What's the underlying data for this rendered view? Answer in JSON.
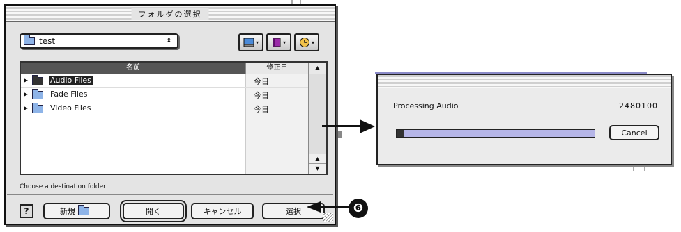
{
  "folder_dialog": {
    "title": "フォルダの選択",
    "location_popup": {
      "value": "test",
      "arrows": "⬍"
    },
    "toolbar_icons": [
      "desktop-icon",
      "book-icon",
      "recent-icon"
    ],
    "columns": {
      "name": "名前",
      "date": "修正日",
      "sort_arrow": "▲"
    },
    "rows": [
      {
        "name": "Audio Files",
        "date": "今日",
        "selected": true
      },
      {
        "name": "Fade Files",
        "date": "今日",
        "selected": false
      },
      {
        "name": "Video Files",
        "date": "今日",
        "selected": false
      }
    ],
    "hint": "Choose a destination folder",
    "buttons": {
      "help": "?",
      "new_folder": "新規",
      "open": "開く",
      "cancel": "キャンセル",
      "choose": "選択"
    }
  },
  "progress_window": {
    "status": "Processing Audio",
    "count": "2480100",
    "progress_fraction": 0.04,
    "cancel": "Cancel"
  },
  "callout": {
    "label": "❻"
  },
  "colors": {
    "progress_track": "#b6b6e8",
    "selection": "#222222"
  }
}
